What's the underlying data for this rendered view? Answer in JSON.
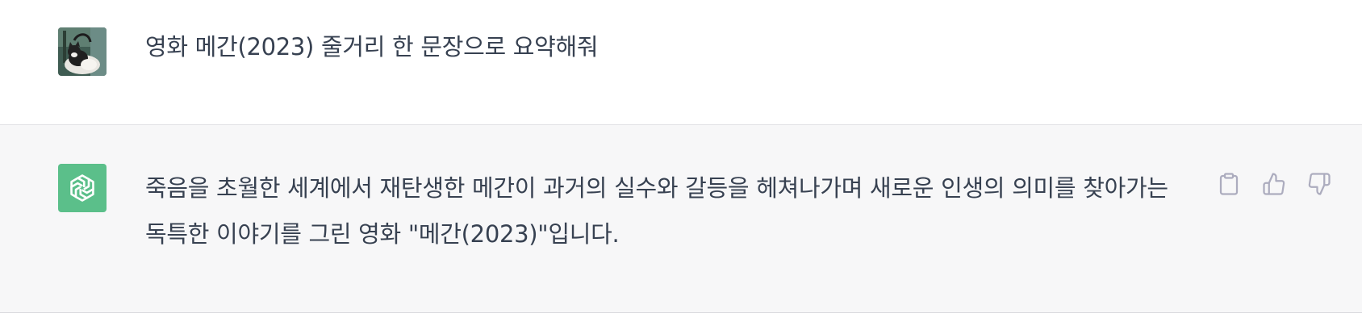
{
  "user_message": {
    "text": "영화 메간(2023) 줄거리 한 문장으로 요약해줘",
    "avatar": "user-cat-photo-avatar"
  },
  "assistant_message": {
    "text": "죽음을 초월한 세계에서 재탄생한 메간이 과거의 실수와 갈등을 헤쳐나가며 새로운 인생의 의미를 찾아가는 독특한 이야기를 그린 영화 \"메간(2023)\"입니다.",
    "avatar": "openai-logo-icon",
    "avatar_color": "#19c37d"
  },
  "actions": [
    {
      "icon": "clipboard-icon"
    },
    {
      "icon": "thumbs-up-icon"
    },
    {
      "icon": "thumbs-down-icon"
    }
  ],
  "colors": {
    "assistant_bg": "#f7f7f8",
    "text": "#374151",
    "icon": "#acacbe"
  }
}
